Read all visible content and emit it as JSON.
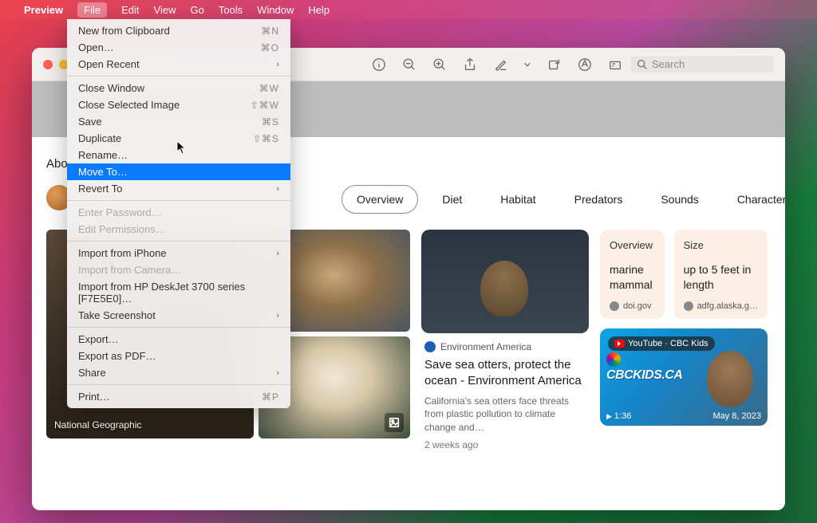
{
  "menubar": {
    "app_name": "Preview",
    "items": [
      "File",
      "Edit",
      "View",
      "Go",
      "Tools",
      "Window",
      "Help"
    ],
    "active_index": 0
  },
  "file_menu": {
    "groups": [
      [
        {
          "label": "New from Clipboard",
          "shortcut": "⌘N"
        },
        {
          "label": "Open…",
          "shortcut": "⌘O"
        },
        {
          "label": "Open Recent",
          "chevron": true
        }
      ],
      [
        {
          "label": "Close Window",
          "shortcut": "⌘W"
        },
        {
          "label": "Close Selected Image",
          "shortcut": "⇧⌘W"
        },
        {
          "label": "Save",
          "shortcut": "⌘S"
        },
        {
          "label": "Duplicate",
          "shortcut": "⇧⌘S"
        },
        {
          "label": "Rename…"
        },
        {
          "label": "Move To…",
          "highlighted": true
        },
        {
          "label": "Revert To",
          "chevron": true
        }
      ],
      [
        {
          "label": "Enter Password…",
          "disabled": true
        },
        {
          "label": "Edit Permissions…",
          "disabled": true
        }
      ],
      [
        {
          "label": "Import from iPhone",
          "chevron": true
        },
        {
          "label": "Import from Camera…",
          "disabled": true
        },
        {
          "label": "Import from HP DeskJet 3700 series [F7E5E0]…"
        },
        {
          "label": "Take Screenshot",
          "chevron": true
        }
      ],
      [
        {
          "label": "Export…"
        },
        {
          "label": "Export as PDF…"
        },
        {
          "label": "Share",
          "chevron": true
        }
      ],
      [
        {
          "label": "Print…",
          "shortcut": "⌘P"
        }
      ]
    ]
  },
  "toolbar": {
    "search_placeholder": "Search"
  },
  "page": {
    "about_label": "Abo",
    "tabs": [
      "Overview",
      "Diet",
      "Habitat",
      "Predators",
      "Sounds",
      "Characteristics"
    ],
    "active_tab": 0,
    "img_big_label": "National Geographic",
    "article": {
      "source": "Environment America",
      "title": "Save sea otters, protect the ocean - Environment America",
      "desc": "California's sea otters face threats from plastic pollution to climate change and…",
      "time": "2 weeks ago"
    },
    "info_cards": [
      {
        "title": "Overview",
        "value": "marine mammal",
        "source": "doi.gov"
      },
      {
        "title": "Size",
        "value": "up to 5 feet in length",
        "source": "adfg.alaska.g…"
      }
    ],
    "video": {
      "badge": "YouTube · CBC Kids",
      "overlay_text": "CBCKIDS.CA",
      "duration": "1:36",
      "date": "May 8, 2023"
    }
  }
}
